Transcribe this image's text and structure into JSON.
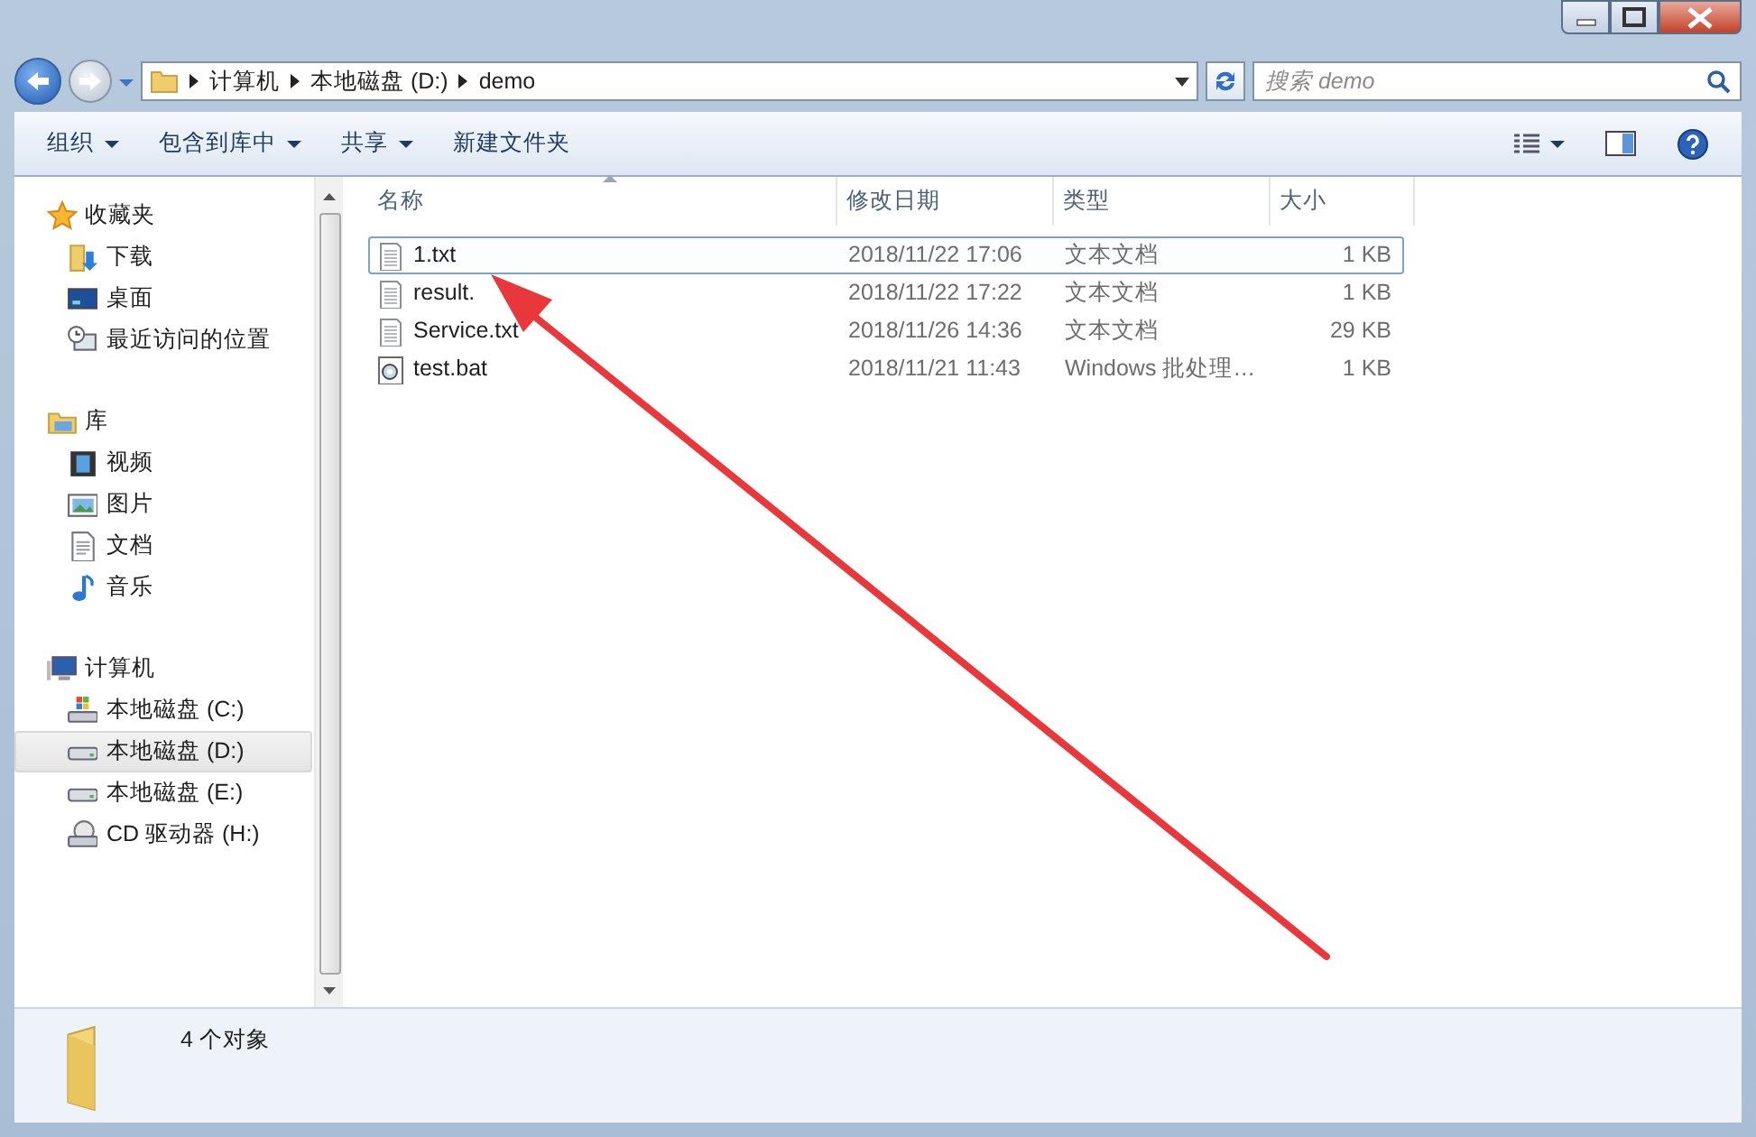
{
  "address": {
    "path": [
      "计算机",
      "本地磁盘 (D:)",
      "demo"
    ]
  },
  "search": {
    "placeholder": "搜索 demo"
  },
  "toolbar": {
    "buttons": [
      {
        "label": "组织",
        "dropdown": true
      },
      {
        "label": "包含到库中",
        "dropdown": true
      },
      {
        "label": "共享",
        "dropdown": true
      },
      {
        "label": "新建文件夹",
        "dropdown": false
      }
    ]
  },
  "sidebar": {
    "sections": [
      {
        "label": "收藏夹",
        "kind": "star",
        "items": [
          {
            "label": "下载",
            "kind": "download",
            "selected": false
          },
          {
            "label": "桌面",
            "kind": "desktop",
            "selected": false
          },
          {
            "label": "最近访问的位置",
            "kind": "recent",
            "selected": false
          }
        ]
      },
      {
        "label": "库",
        "kind": "library",
        "items": [
          {
            "label": "视频",
            "kind": "video",
            "selected": false
          },
          {
            "label": "图片",
            "kind": "picture",
            "selected": false
          },
          {
            "label": "文档",
            "kind": "document",
            "selected": false
          },
          {
            "label": "音乐",
            "kind": "music",
            "selected": false
          }
        ]
      },
      {
        "label": "计算机",
        "kind": "computer",
        "items": [
          {
            "label": "本地磁盘 (C:)",
            "kind": "system-drive",
            "selected": false
          },
          {
            "label": "本地磁盘 (D:)",
            "kind": "drive",
            "selected": true
          },
          {
            "label": "本地磁盘 (E:)",
            "kind": "drive",
            "selected": false
          },
          {
            "label": "CD 驱动器 (H:)",
            "kind": "cd-drive",
            "selected": false
          }
        ]
      }
    ]
  },
  "table": {
    "columns": [
      {
        "label": "名称",
        "sorted": true
      },
      {
        "label": "修改日期",
        "sorted": false
      },
      {
        "label": "类型",
        "sorted": false
      },
      {
        "label": "大小",
        "sorted": false
      }
    ],
    "rows": [
      {
        "name": "1.txt",
        "modified": "2018/11/22 17:06",
        "type": "文本文档",
        "size": "1 KB",
        "kind": "text",
        "selected": true
      },
      {
        "name": "result.",
        "modified": "2018/11/22 17:22",
        "type": "文本文档",
        "size": "1 KB",
        "kind": "text",
        "selected": false
      },
      {
        "name": "Service.txt",
        "modified": "2018/11/26 14:36",
        "type": "文本文档",
        "size": "29 KB",
        "kind": "text",
        "selected": false
      },
      {
        "name": "test.bat",
        "modified": "2018/11/21 11:43",
        "type": "Windows 批处理…",
        "size": "1 KB",
        "kind": "batch",
        "selected": false
      }
    ]
  },
  "status_bar": {
    "text": "4 个对象"
  },
  "annotation": {
    "kind": "arrow",
    "color": "#e8383b"
  }
}
